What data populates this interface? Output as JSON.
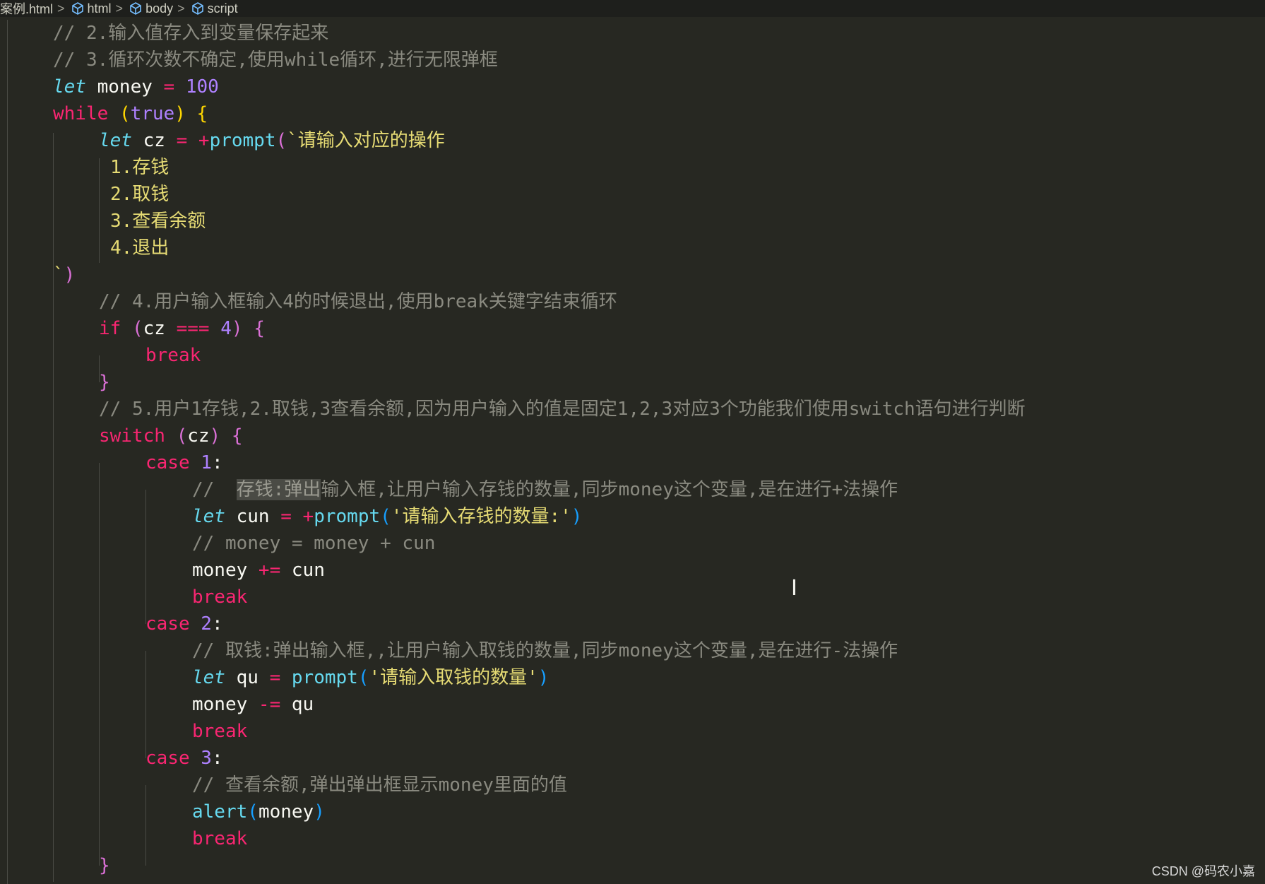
{
  "breadcrumb": {
    "file": "案例.html",
    "items": [
      {
        "label": "html",
        "icon": "cube-icon"
      },
      {
        "label": "body",
        "icon": "cube-icon"
      },
      {
        "label": "script",
        "icon": "cube-icon"
      }
    ]
  },
  "code": {
    "l01": "// 2.输入值存入到变量保存起来",
    "l02": "// 3.循环次数不确定,使用while循环,进行无限弹框",
    "l03_kw": "let",
    "l03_var": " money ",
    "l03_op": "=",
    "l03_num": " 100",
    "l04_kw": "while",
    "l04_sp": " ",
    "l04_po": "(",
    "l04_val": "true",
    "l04_pc": ")",
    "l04_sp2": " ",
    "l04_brace": "{",
    "l05_kw": "let",
    "l05_var": " cz ",
    "l05_op": "=",
    "l05_op2": " +",
    "l05_fn": "prompt",
    "l05_paren": "(",
    "l05_str": "`请输入对应的操作",
    "l06": "1.存钱",
    "l07": "2.取钱",
    "l08": "3.查看余额",
    "l09": "4.退出",
    "l10_str": "`",
    "l10_paren": ")",
    "l11": "// 4.用户输入框输入4的时候退出,使用break关键字结束循环",
    "l12_kw": "if",
    "l12_sp": " ",
    "l12_po": "(",
    "l12_var": "cz ",
    "l12_op": "===",
    "l12_num": " 4",
    "l12_pc": ")",
    "l12_sp2": " ",
    "l12_brace": "{",
    "l13_kw": "break",
    "l14_brace": "}",
    "l15": "// 5.用户1存钱,2.取钱,3查看余额,因为用户输入的值是固定1,2,3对应3个功能我们使用switch语句进行判断",
    "l16_kw": "switch",
    "l16_sp": " ",
    "l16_po": "(",
    "l16_var": "cz",
    "l16_pc": ")",
    "l16_sp2": " ",
    "l16_brace": "{",
    "l17_kw": "case",
    "l17_num": " 1",
    "l17_colon": ":",
    "l18_pre": "//  ",
    "l18_hl": "存钱:弹出",
    "l18_rest": "输入框,让用户输入存钱的数量,同步money这个变量,是在进行+法操作",
    "l19_kw": "let",
    "l19_var": " cun ",
    "l19_op": "=",
    "l19_op2": " +",
    "l19_fn": "prompt",
    "l19_po": "(",
    "l19_str": "'请输入存钱的数量:'",
    "l19_pc": ")",
    "l20": "// money = money + cun",
    "l21_var": "money ",
    "l21_op": "+=",
    "l21_var2": " cun",
    "l22_kw": "break",
    "l23_kw": "case",
    "l23_num": " 2",
    "l23_colon": ":",
    "l24": "// 取钱:弹出输入框,,让用户输入取钱的数量,同步money这个变量,是在进行-法操作",
    "l25_kw": "let",
    "l25_var": " qu ",
    "l25_op": "=",
    "l25_sp": " ",
    "l25_fn": "prompt",
    "l25_po": "(",
    "l25_str": "'请输入取钱的数量'",
    "l25_pc": ")",
    "l26_var": "money ",
    "l26_op": "-=",
    "l26_var2": " qu",
    "l27_kw": "break",
    "l28_kw": "case",
    "l28_num": " 3",
    "l28_colon": ":",
    "l29": "// 查看余额,弹出弹出框显示money里面的值",
    "l30_fn": "alert",
    "l30_po": "(",
    "l30_var": "money",
    "l30_pc": ")",
    "l31_kw": "break",
    "l32_brace": "}"
  },
  "watermark": "CSDN @码农小嘉",
  "colors": {
    "background": "#272822",
    "keyword": "#f92672",
    "storage": "#66d9ef",
    "number": "#ae81ff",
    "string": "#e6db74",
    "comment": "#8a8a80"
  }
}
